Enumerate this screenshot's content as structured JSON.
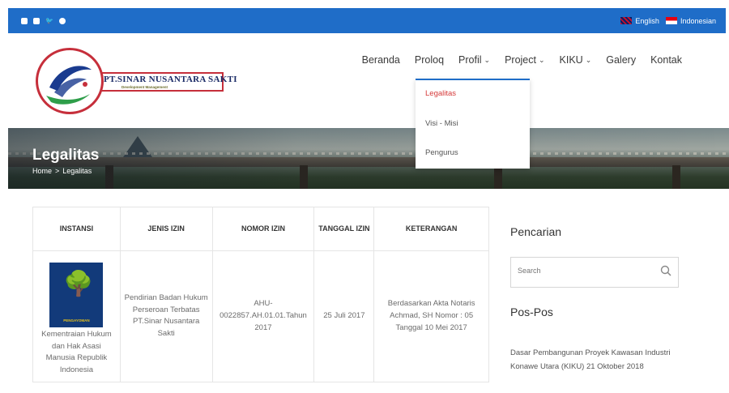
{
  "topbar": {
    "social_icons": [
      "facebook-icon",
      "linkedin-icon",
      "twitter-icon",
      "dribbble-icon"
    ],
    "languages": [
      {
        "label": "English",
        "flag": "uk-flag-icon"
      },
      {
        "label": "Indonesian",
        "flag": "id-flag-icon"
      }
    ],
    "color": "#1f6dc8"
  },
  "logo": {
    "title": "PT.SINAR NUSANTARA SAKTI",
    "subtitle": "Development Management"
  },
  "nav": {
    "items": [
      {
        "label": "Beranda",
        "has_dropdown": false
      },
      {
        "label": "Proloq",
        "has_dropdown": false
      },
      {
        "label": "Profil",
        "has_dropdown": true
      },
      {
        "label": "Project",
        "has_dropdown": true
      },
      {
        "label": "KIKU",
        "has_dropdown": true
      },
      {
        "label": "Galery",
        "has_dropdown": false
      },
      {
        "label": "Kontak",
        "has_dropdown": false
      }
    ],
    "dropdown": {
      "items": [
        "Legalitas",
        "Visi - Misi",
        "Pengurus"
      ],
      "active": "Legalitas",
      "active_color": "#d53a3a"
    }
  },
  "hero": {
    "title": "Legalitas",
    "breadcrumb": [
      "Home",
      ">",
      "Legalitas"
    ]
  },
  "table": {
    "headers": [
      "INSTANSI",
      "JENIS IZIN",
      "NOMOR IZIN",
      "TANGGAL IZIN",
      "KETERANGAN"
    ],
    "rows": [
      {
        "logo_label": "PENGAYOMAN",
        "instansi": "Kementraian Hukum dan Hak Asasi Manusia Republik Indonesia",
        "jenis_izin": "Pendirian Badan Hukum Perseroan Terbatas PT.Sinar Nusantara Sakti",
        "nomor_izin": "AHU-0022857.AH.01.01.Tahun 2017",
        "tanggal_izin": "25 Juli 2017",
        "keterangan": "Berdasarkan Akta Notaris Achmad, SH Nomor : 05 Tanggal 10 Mei 2017"
      }
    ]
  },
  "sidebar": {
    "search_title": "Pencarian",
    "search_placeholder": "Search",
    "posts_title": "Pos-Pos",
    "posts": [
      "Dasar Pembangunan Proyek Kawasan Industri Konawe Utara (KIKU) 21 Oktober 2018"
    ]
  }
}
